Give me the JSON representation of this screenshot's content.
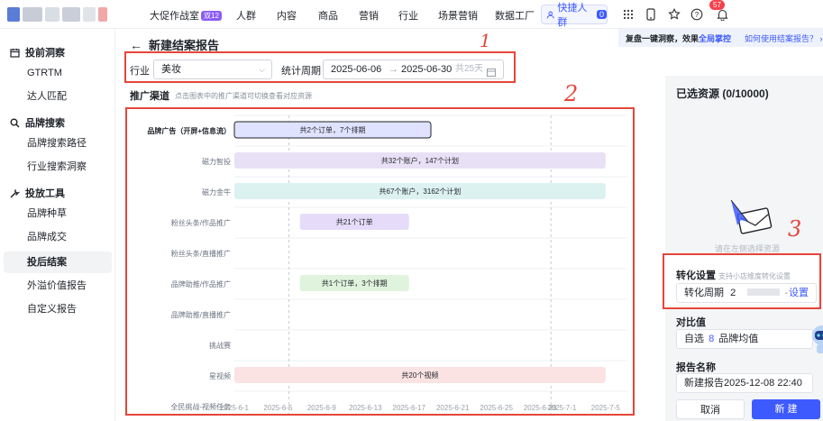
{
  "topnav": {
    "studio_label": "大促作战室",
    "studio_badge": "双12",
    "items": [
      "人群",
      "内容",
      "商品",
      "营销",
      "行业",
      "场景营销",
      "数据工厂"
    ],
    "quick_label": "快捷人群",
    "quick_count": "0",
    "notification_count": "57",
    "icons": [
      "apps-icon",
      "mobile-icon",
      "star-check-icon",
      "help-icon",
      "bell-icon"
    ]
  },
  "sidebar": {
    "groups": [
      {
        "icon": "calendar-icon",
        "label": "投前洞察",
        "items": [
          "GTRTM",
          "达人匹配"
        ]
      },
      {
        "icon": "search-icon",
        "label": "品牌搜索",
        "items": [
          "品牌搜索路径",
          "行业搜索洞察"
        ]
      },
      {
        "icon": "tools-icon",
        "label": "投放工具",
        "items": [
          "品牌种草",
          "品牌成交",
          "投后结案",
          "外溢价值报告",
          "自定义报告"
        ]
      }
    ],
    "active_item": "投后结案"
  },
  "page": {
    "title": "新建结案报告",
    "industry_label": "行业",
    "industry_value": "美妆",
    "period_label": "统计周期",
    "date_start": "2025-06-06",
    "date_arrow": "→",
    "date_end": "2025-06-30",
    "date_days": "共25天"
  },
  "promo": {
    "text_a": "复盘一键洞察，效果",
    "text_hl": "全局掌控",
    "link": "如何使用结案报告？"
  },
  "channels": {
    "title": "推广渠道",
    "hint": "点击图表中的推广渠道可切换查看对应资源"
  },
  "chart_data": {
    "type": "gantt",
    "rows": [
      "品牌广告（开屏+信息流）",
      "磁力智投",
      "磁力金牛",
      "粉丝头条/作品推广",
      "粉丝头条/直播推广",
      "品牌助推/作品推广",
      "品牌助推/直播推广",
      "挑战赛",
      "星视频",
      "全民挑战-视频任务"
    ],
    "x_ticks": [
      "2025-6-1",
      "2025-6-5",
      "2025-6-9",
      "2025-6-13",
      "2025-6-17",
      "2025-6-21",
      "2025-6-25",
      "2025-6-29",
      "2025-7-1",
      "2025-7-5"
    ],
    "range_markers": [
      "2025-06-06",
      "2025-06-30"
    ],
    "bars": [
      {
        "row": 0,
        "start": "2025-06-01",
        "end": "2025-06-19",
        "label": "共2个订单，7个排期",
        "color": "#dfe3ff",
        "border": "#1f2329"
      },
      {
        "row": 1,
        "start": "2025-06-01",
        "end": "2025-07-05",
        "label": "共32个账户，147个计划",
        "color": "#e8e1f5"
      },
      {
        "row": 2,
        "start": "2025-06-01",
        "end": "2025-07-05",
        "label": "共67个账户，3162个计划",
        "color": "#dcf2f1"
      },
      {
        "row": 3,
        "start": "2025-06-07",
        "end": "2025-06-17",
        "label": "共21个订单",
        "color": "#e6dcfa"
      },
      {
        "row": 5,
        "start": "2025-06-07",
        "end": "2025-06-17",
        "label": "共1个订单，3个排期",
        "color": "#e0f3dc"
      },
      {
        "row": 8,
        "start": "2025-06-01",
        "end": "2025-07-05",
        "label": "共20个视频",
        "color": "#fbe3e3"
      }
    ]
  },
  "selected": {
    "title": "已选资源 (0/10000)",
    "empty_text": "请在左侧选择资源"
  },
  "conversion": {
    "label": "转化设置",
    "sub": "支持小店维度转化设置",
    "field_label": "转化周期",
    "field_value": "2",
    "field_link": "设置"
  },
  "compare": {
    "label": "对比值",
    "value_a": "自选",
    "value_num": "8",
    "value_b": "品牌均值"
  },
  "report": {
    "label": "报告名称",
    "value": "新建报告2025-12-08 22:40"
  },
  "actions": {
    "cancel": "取消",
    "create": "新 建"
  },
  "annotations": [
    "1",
    "2",
    "3"
  ],
  "colors": {
    "accent": "#3d5afe",
    "annotation": "#e5463a"
  }
}
